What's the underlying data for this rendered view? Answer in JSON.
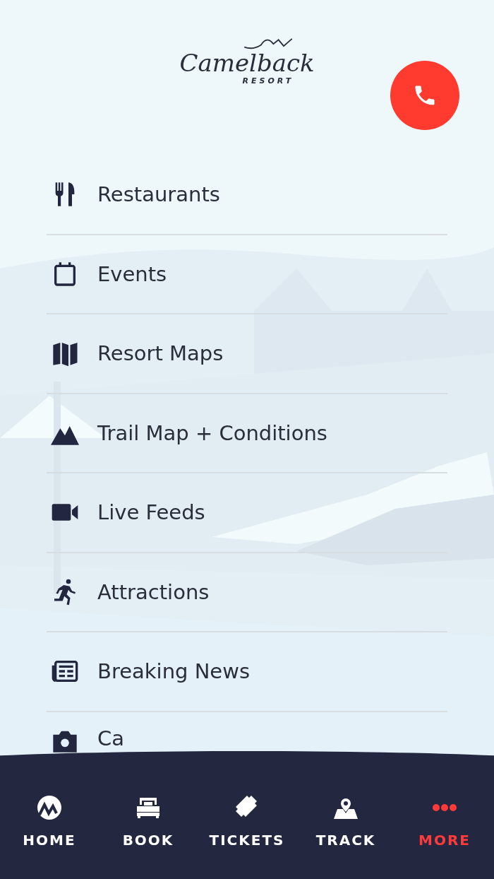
{
  "logo": {
    "name": "Camelback",
    "subtitle": "RESORT"
  },
  "menu": [
    {
      "label": "Restaurants"
    },
    {
      "label": "Events"
    },
    {
      "label": "Resort Maps"
    },
    {
      "label": "Trail Map + Conditions"
    },
    {
      "label": "Live Feeds"
    },
    {
      "label": "Attractions"
    },
    {
      "label": "Breaking News"
    },
    {
      "label": "Ca"
    }
  ],
  "tab_bar": [
    {
      "label": "HOME",
      "selected": false
    },
    {
      "label": "BOOK",
      "selected": false
    },
    {
      "label": "TICKETS",
      "selected": false
    },
    {
      "label": "TRACK",
      "selected": false
    },
    {
      "label": "MORE",
      "selected": true
    }
  ]
}
